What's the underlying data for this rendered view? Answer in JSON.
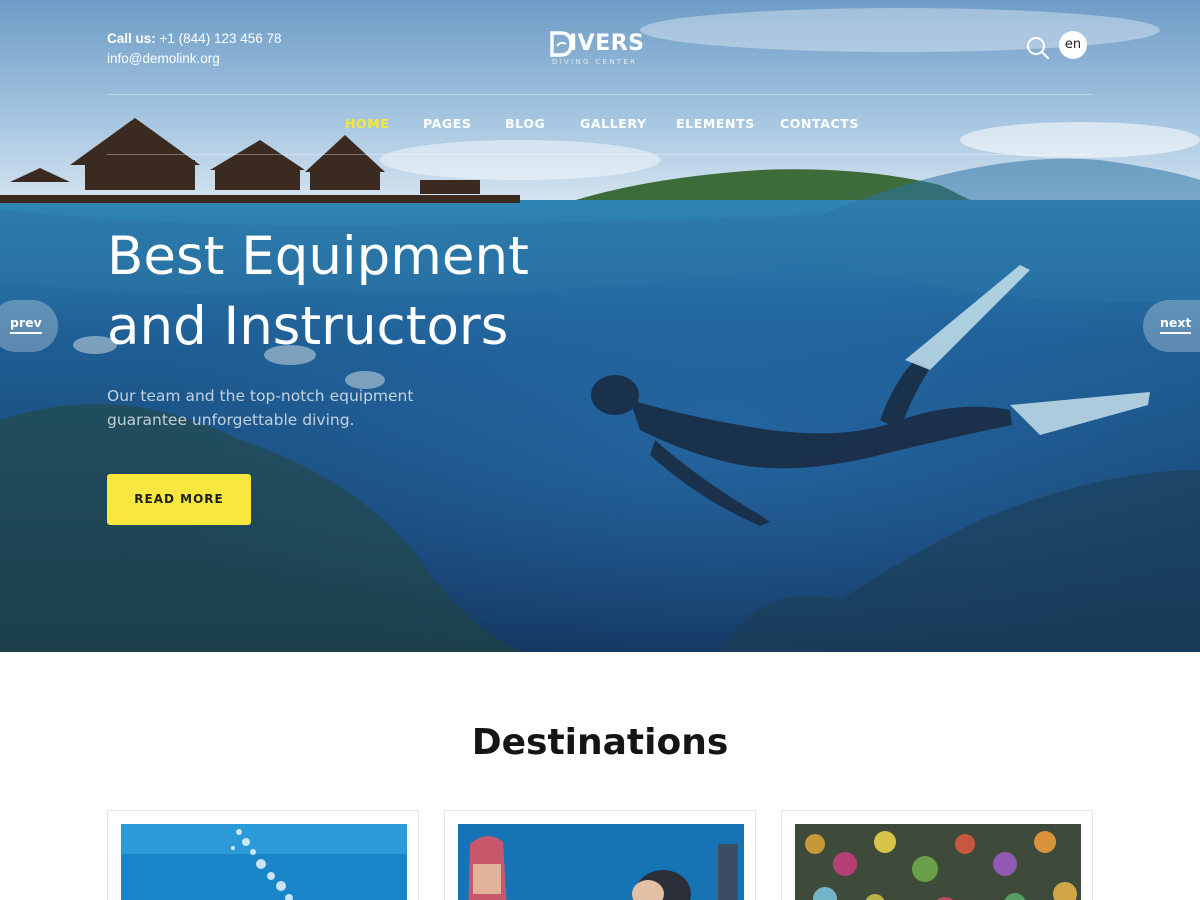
{
  "header": {
    "phone_label": "Call us:",
    "phone": "+1 (844) 123 456 78",
    "email": "info@demolink.org",
    "logo_title": "IVERS",
    "logo_initial": "D",
    "logo_subtitle": "DIVING CENTER",
    "language": "en"
  },
  "nav": {
    "items": [
      {
        "label": "HOME",
        "active": true
      },
      {
        "label": "PAGES"
      },
      {
        "label": "BLOG"
      },
      {
        "label": "GALLERY"
      },
      {
        "label": "ELEMENTS"
      },
      {
        "label": "CONTACTS"
      }
    ],
    "active_color": "#f7e733"
  },
  "hero": {
    "title_line1": "Best Equipment",
    "title_line2": "and Instructors",
    "subtitle": "Our team and the top-notch equipment guarantee unforgettable diving.",
    "cta_label": "READ MORE",
    "prev_label": "prev",
    "next_label": "next",
    "cta_color": "#f7e73f"
  },
  "destinations": {
    "title": "Destinations",
    "cards": [
      {
        "image": "underwater-bubbles-fish"
      },
      {
        "image": "diver-coral"
      },
      {
        "image": "colorful-coral-reef"
      }
    ]
  }
}
